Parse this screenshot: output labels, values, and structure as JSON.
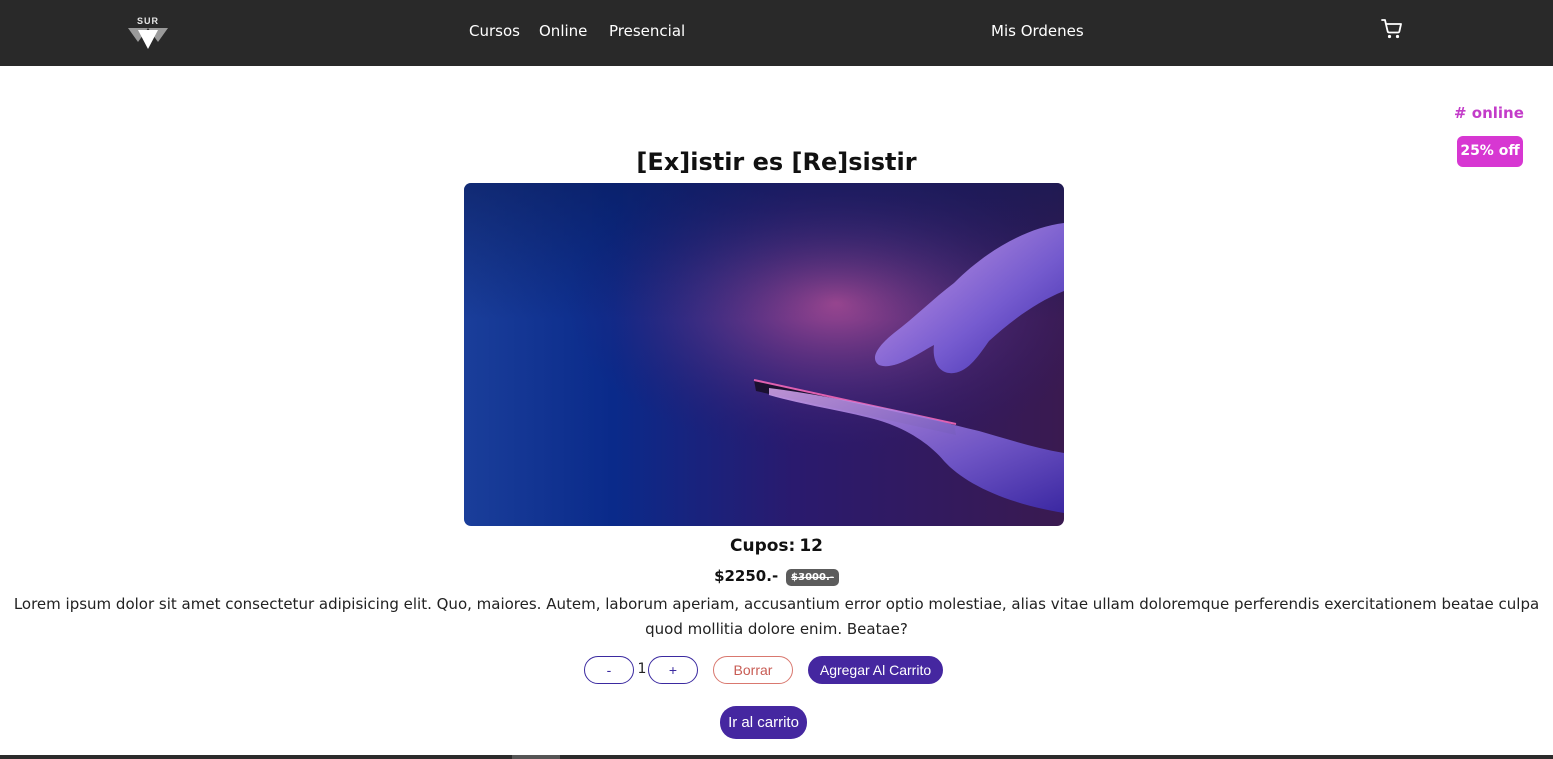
{
  "navbar": {
    "logo_text": "SUR",
    "links": [
      {
        "label": "Cursos"
      },
      {
        "label": "Online"
      },
      {
        "label": "Presencial"
      }
    ],
    "orders_label": "Mis Ordenes",
    "cart_icon": "shopping-cart-icon"
  },
  "course": {
    "tag": "# online",
    "discount": "25% off",
    "title": "[Ex]istir es [Re]sistir",
    "image_description_icon": "hands-with-phone-image",
    "cupos_label": "Cupos:",
    "cupos_value": "12",
    "price": "$2250.-",
    "old_price": "$3000.-",
    "description": "Lorem ipsum dolor sit amet consectetur adipisicing elit. Quo, maiores. Autem, laborum aperiam, accusantium error optio molestiae, alias vitae ullam doloremque perferendis exercitationem beatae culpa quod mollitia dolore enim. Beatae?"
  },
  "controls": {
    "decrement_label": "-",
    "quantity": "1",
    "increment_label": "+",
    "delete_label": "Borrar",
    "add_label": "Agregar Al Carrito",
    "go_to_cart_label": "Ir al carrito"
  },
  "colors": {
    "navbar_bg": "#292929",
    "accent_purple": "#4527a0",
    "tag_pink": "#c33cc9",
    "badge_pink": "#d737d2"
  }
}
